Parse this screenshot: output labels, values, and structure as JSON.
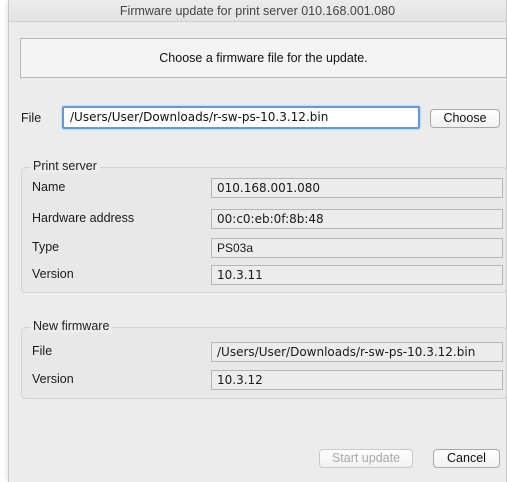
{
  "window": {
    "title": "Firmware update for print server 010.168.001.080"
  },
  "header": {
    "message": "Choose a firmware file for the update."
  },
  "file_select": {
    "label": "File",
    "value": "/Users/User/Downloads/r-sw-ps-10.3.12.bin",
    "choose_label": "Choose"
  },
  "print_server": {
    "title": "Print server",
    "name_label": "Name",
    "name_value": "010.168.001.080",
    "hw_label": "Hardware address",
    "hw_value": "00:c0:eb:0f:8b:48",
    "type_label": "Type",
    "type_value": "PS03a",
    "version_label": "Version",
    "version_value": "10.3.11"
  },
  "new_firmware": {
    "title": "New firmware",
    "file_label": "File",
    "file_value": "/Users/User/Downloads/r-sw-ps-10.3.12.bin",
    "version_label": "Version",
    "version_value": "10.3.12"
  },
  "footer": {
    "start_label": "Start update",
    "cancel_label": "Cancel"
  },
  "colors": {
    "focus_ring": "#5d9be6",
    "window_bg": "#ececec"
  }
}
